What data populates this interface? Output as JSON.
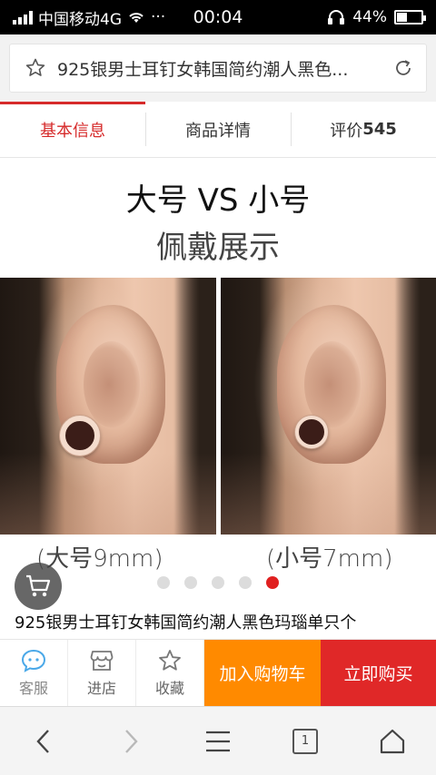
{
  "status_bar": {
    "carrier": "中国移动4G",
    "more": "···",
    "time": "00:04",
    "battery_percent": "44%",
    "battery_level": 0.44
  },
  "url_bar": {
    "page_title": "925银男士耳钉女韩国简约潮人黑色..."
  },
  "tabs": [
    {
      "label": "基本信息",
      "active": true
    },
    {
      "label": "商品详情",
      "active": false
    },
    {
      "label": "评价",
      "count": "545",
      "active": false
    }
  ],
  "gallery": {
    "title": "大号 VS 小号",
    "subtitle": "佩戴展示",
    "left_caption": "(大号9mm)",
    "right_caption": "(小号7mm)",
    "slide_count": 5,
    "active_slide": 5
  },
  "product": {
    "title": "925银男士耳钉女韩国简约潮人黑色玛瑙单只个"
  },
  "action_bar": {
    "service": "客服",
    "store": "进店",
    "favorite": "收藏",
    "add_to_cart": "加入购物车",
    "buy_now": "立即购买"
  },
  "browser_nav": {
    "tab_count": "1"
  },
  "colors": {
    "accent_red": "#e02828",
    "orange": "#ff8a00",
    "service_blue": "#4aa8e8"
  }
}
